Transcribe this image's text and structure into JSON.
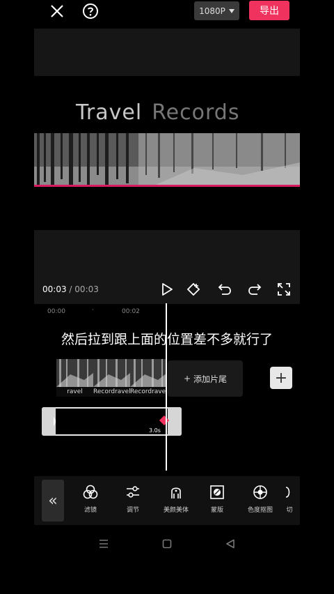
{
  "top": {
    "resolution": "1080P",
    "export_label": "导出"
  },
  "preview": {
    "title_word1": "Travel",
    "title_word2": "Records",
    "current_time": "00:03",
    "separator": "/",
    "total_time": "00:03"
  },
  "timeline": {
    "ruler": [
      "00:00",
      "00:02"
    ],
    "subtitle": "然后拉到跟上面的位置差不多就行了",
    "thumb_labels": [
      "ravel",
      "Recordravel",
      "Recordravel",
      "Record"
    ],
    "add_ending_label": "添加片尾",
    "clip_duration": "3.0s"
  },
  "toolbar": {
    "tools": [
      {
        "label": "滤镜",
        "icon": "filter-icon"
      },
      {
        "label": "调节",
        "icon": "adjust-icon"
      },
      {
        "label": "美颜美体",
        "icon": "beauty-icon"
      },
      {
        "label": "蒙版",
        "icon": "mask-icon"
      },
      {
        "label": "色度抠图",
        "icon": "chroma-key-icon"
      },
      {
        "label": "切",
        "icon": "cut-icon"
      }
    ]
  },
  "colors": {
    "accent": "#f0335e",
    "background": "#000000",
    "panel": "#161616"
  }
}
